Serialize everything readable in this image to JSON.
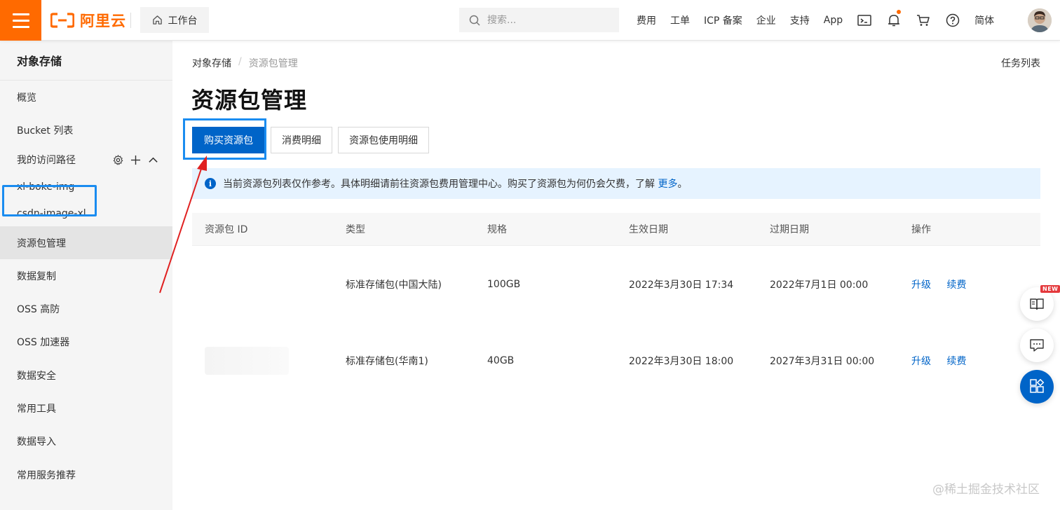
{
  "brand": {
    "name": "阿里云",
    "color": "#ff6a00"
  },
  "header": {
    "workbench_label": "工作台",
    "search_placeholder": "搜索...",
    "links": [
      "费用",
      "工单",
      "ICP 备案",
      "企业",
      "支持",
      "App"
    ],
    "language": "简体"
  },
  "sidebar": {
    "title": "对象存储",
    "items": {
      "overview": "概览",
      "bucket_list": "Bucket 列表",
      "access_paths": "我的访问路径",
      "path_1": "xl-boke-img",
      "path_2": "csdn-image-xl",
      "package_mgmt": "资源包管理",
      "replication": "数据复制",
      "oss_protect": "OSS 高防",
      "oss_accelerator": "OSS 加速器",
      "data_security": "数据安全",
      "tools": "常用工具",
      "data_import": "数据导入",
      "recommend": "常用服务推荐"
    }
  },
  "main": {
    "breadcrumb_root": "对象存储",
    "breadcrumb_sep": "/",
    "breadcrumb_current": "资源包管理",
    "task_list": "任务列表",
    "title": "资源包管理",
    "buttons": {
      "buy": "购买资源包",
      "consumption": "消费明细",
      "usage": "资源包使用明细"
    },
    "notice_text": "当前资源包列表仅作参考。具体明细请前往资源包费用管理中心。购买了资源包为何仍会欠费，了解",
    "notice_link": "更多",
    "notice_end": "。",
    "table": {
      "headers": [
        "资源包 ID",
        "类型",
        "规格",
        "生效日期",
        "过期日期",
        "操作"
      ],
      "rows": [
        {
          "type": "标准存储包(中国大陆)",
          "spec": "100GB",
          "start": "2022年3月30日 17:34",
          "end": "2022年7月1日 00:00",
          "op1": "升级",
          "op2": "续费"
        },
        {
          "type": "标准存储包(华南1)",
          "spec": "40GB",
          "start": "2022年3月30日 18:00",
          "end": "2027年3月31日 00:00",
          "op1": "升级",
          "op2": "续费"
        }
      ]
    }
  },
  "floating": {
    "new_badge": "NEW"
  },
  "watermark": "@稀土掘金技术社区",
  "colors": {
    "primary": "#0064c8",
    "highlight": "#1a8cf0",
    "annotation_arrow": "#e02020"
  }
}
